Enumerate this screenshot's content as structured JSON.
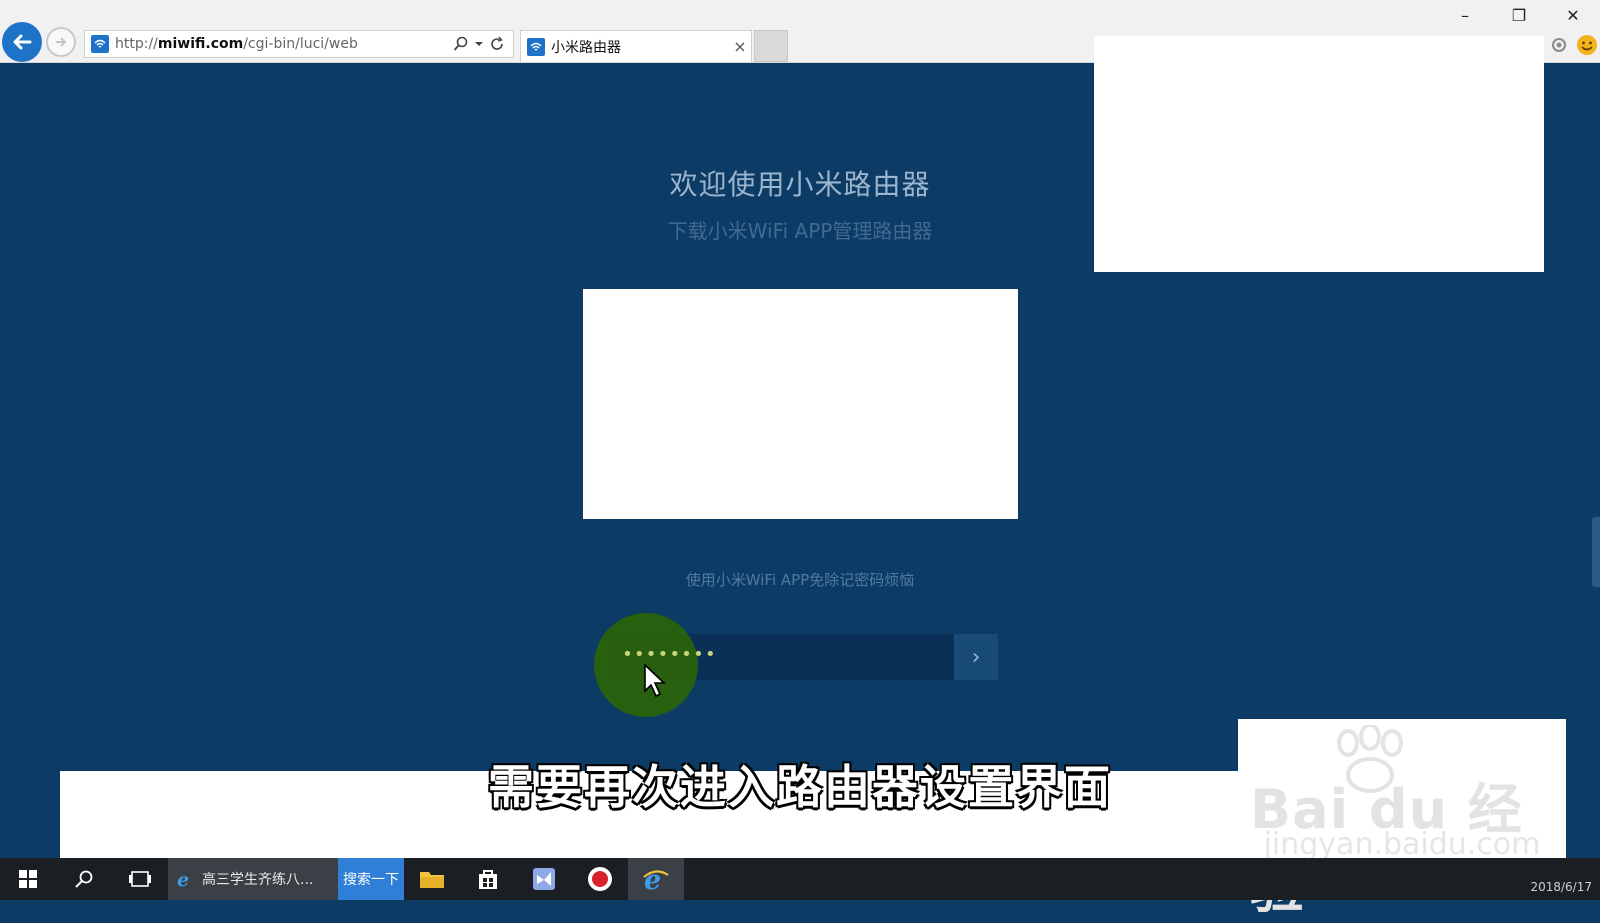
{
  "browser": {
    "url_prefix": "http://",
    "url_domain": "miwifi.com",
    "url_path": "/cgi-bin/luci/web",
    "tab_title": "小米路由器",
    "tab_close": "×",
    "window_controls": {
      "minimize": "–",
      "restore": "❐",
      "close": "✕"
    }
  },
  "page": {
    "title": "欢迎使用小米路由器",
    "subtitle": "下载小米WiFi APP管理路由器",
    "hint": "使用小米WiFi APP免除记密码烦恼",
    "password_value": "••••••••",
    "submit_glyph": "›"
  },
  "video_caption": "需要再次进入路由器设置界面",
  "watermark": {
    "logo": "Bai du 经验",
    "url": "jingyan.baidu.com"
  },
  "taskbar": {
    "search_app_label": "高三学生齐练八...",
    "search_button": "搜索一下",
    "clock_text": "2018/6/17"
  },
  "colors": {
    "page_bg": "#0c3b66",
    "accent_blue": "#1e73c9",
    "cursor_highlight": "#2a6408"
  }
}
